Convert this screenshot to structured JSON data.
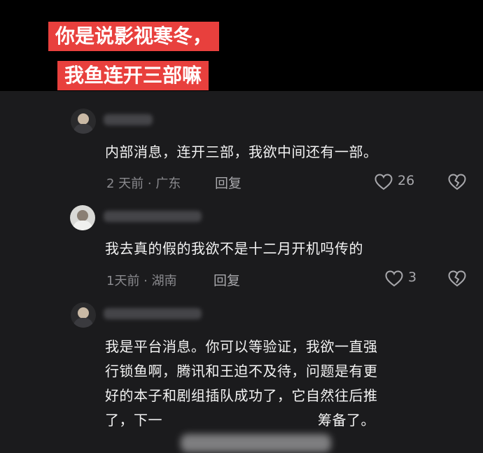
{
  "banner": {
    "line1": "你是说影视寒冬，",
    "line2": "我鱼连开三部嘛"
  },
  "comments": [
    {
      "text_lines": [
        "内部消息，连开三部，我欲中间还有一部。"
      ],
      "time": "2 天前 · 广东",
      "reply_label": "回复",
      "likes": "26"
    },
    {
      "text_lines": [
        "我去真的假的我欲不是十二月开机吗传的"
      ],
      "time": "1天前 · 湖南",
      "reply_label": "回复",
      "likes": "3"
    },
    {
      "text_lines": [
        "我是平台消息。你可以等验证，我欲一直强",
        "行锁鱼啊，腾讯和王迫不及待，问题是有更",
        "好的本子和剧组插队成功了，它自然往后推",
        "了，下一",
        "筹备了。"
      ]
    }
  ],
  "colors": {
    "banner_bg": "#e8403d",
    "panel_bg": "#1b1b1d",
    "meta": "#8a8a8e"
  },
  "icons": {
    "like": "heart-outline-icon",
    "dislike": "broken-heart-icon"
  }
}
